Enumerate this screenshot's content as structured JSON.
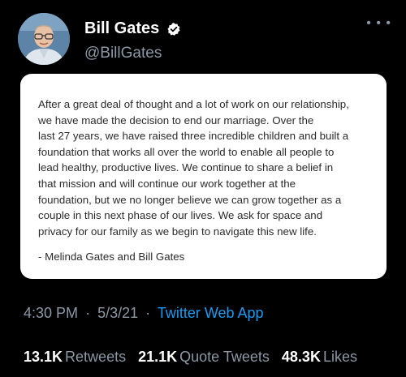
{
  "author": {
    "display_name": "Bill Gates",
    "handle": "@BillGates",
    "verified": true
  },
  "more_icon": "more-icon",
  "statement": {
    "lines": [
      "After a great deal of thought and a lot of work on our relationship,",
      "we have made the decision to end our marriage. Over the",
      "last 27 years, we have raised three incredible children and built a",
      "foundation that works all over the world to enable all people to",
      "lead healthy, productive lives. We continue to share a belief in",
      "that mission and will continue our work together at the",
      "foundation, but we no longer believe we can grow together as a",
      "couple in this next phase of our lives. We ask for space and",
      "privacy for our family as we begin to navigate this new life."
    ],
    "signature": "- Melinda Gates and Bill Gates"
  },
  "meta": {
    "time": "4:30 PM",
    "separator": "·",
    "date": "5/3/21",
    "source": "Twitter Web App"
  },
  "stats": {
    "retweets_count": "13.1K",
    "retweets_label": "Retweets",
    "quotes_count": "21.1K",
    "quotes_label": "Quote Tweets",
    "likes_count": "48.3K",
    "likes_label": "Likes"
  },
  "colors": {
    "background": "#000000",
    "secondary_text": "#8b98a5",
    "link": "#1d9bf0",
    "verified_badge": "#ffffff"
  }
}
